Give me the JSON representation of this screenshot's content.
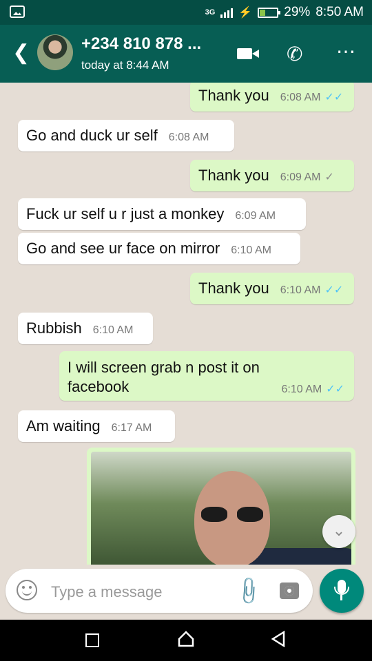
{
  "status_bar": {
    "network": "3G",
    "battery_percent": "29%",
    "battery_level": 0.29,
    "time": "8:50 AM"
  },
  "header": {
    "contact_name": "+234 810 878 ...",
    "last_seen": "today at 8:44 AM"
  },
  "messages": [
    {
      "direction": "out",
      "text": "Thank you",
      "time": "6:08 AM",
      "status": "read",
      "ticks": "✓✓"
    },
    {
      "direction": "in",
      "text": "Go and duck ur self",
      "time": "6:08 AM"
    },
    {
      "direction": "out",
      "text": "Thank you",
      "time": "6:09 AM",
      "status": "sent",
      "ticks": "✓"
    },
    {
      "direction": "in",
      "text": "Fuck ur self u r just a monkey",
      "time": "6:09 AM"
    },
    {
      "direction": "in",
      "text": "Go and see ur face on mirror",
      "time": "6:10 AM"
    },
    {
      "direction": "out",
      "text": "Thank you",
      "time": "6:10 AM",
      "status": "read",
      "ticks": "✓✓"
    },
    {
      "direction": "in",
      "text": "Rubbish",
      "time": "6:10 AM"
    },
    {
      "direction": "out",
      "text": "I will screen grab n post it on facebook",
      "time": "6:10 AM",
      "status": "read",
      "ticks": "✓✓"
    },
    {
      "direction": "in",
      "text": "Am waiting",
      "time": "6:17 AM"
    }
  ],
  "composer": {
    "placeholder": "Type a message"
  },
  "colors": {
    "header": "#075e54",
    "status_bar": "#054d44",
    "outgoing": "#dcf8c6",
    "incoming": "#ffffff",
    "accent": "#00897b"
  }
}
